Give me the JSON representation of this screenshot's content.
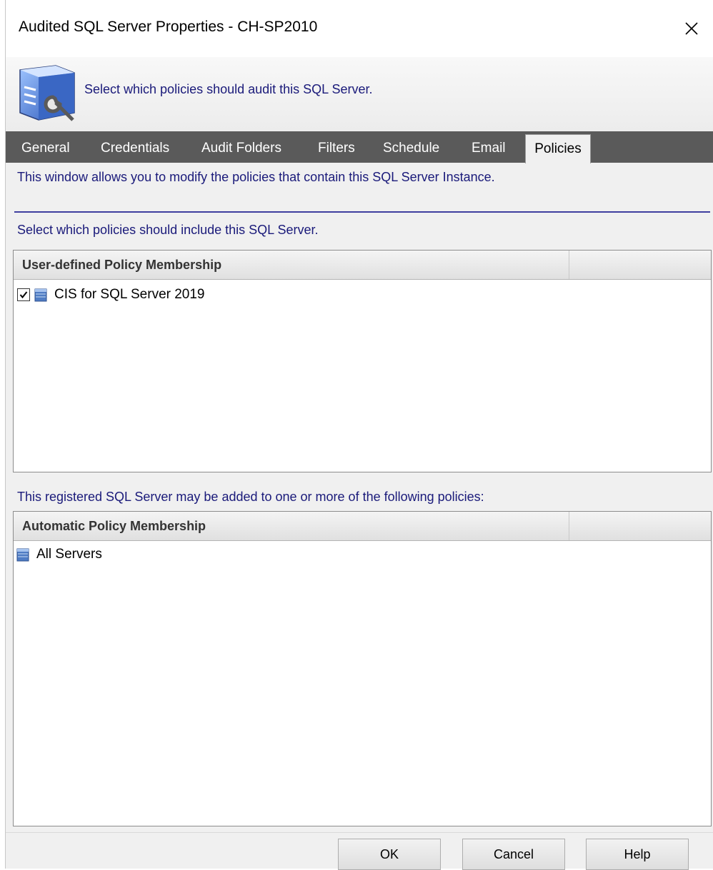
{
  "window": {
    "title": "Audited SQL Server Properties - CH-SP2010"
  },
  "banner": {
    "text": "Select which policies should audit this SQL Server."
  },
  "tabs": [
    {
      "label": "General",
      "active": false
    },
    {
      "label": "Credentials",
      "active": false
    },
    {
      "label": "Audit Folders",
      "active": false
    },
    {
      "label": "Filters",
      "active": false
    },
    {
      "label": "Schedule",
      "active": false
    },
    {
      "label": "Email",
      "active": false
    },
    {
      "label": "Policies",
      "active": true
    }
  ],
  "policies": {
    "info": "This window allows you to modify the policies that contain this SQL Server Instance.",
    "select_prompt": "Select which policies should include this SQL Server.",
    "user_defined": {
      "header": "User-defined Policy Membership",
      "items": [
        {
          "label": "CIS for SQL Server 2019",
          "checked": true
        }
      ]
    },
    "auto_prompt": "This registered SQL Server may be added to one or more of the following policies:",
    "automatic": {
      "header": "Automatic Policy Membership",
      "items": [
        {
          "label": "All Servers"
        }
      ]
    }
  },
  "buttons": {
    "ok": "OK",
    "cancel": "Cancel",
    "help": "Help"
  },
  "colors": {
    "info_text": "#1a1a7a",
    "tabstrip": "#5a5a5a",
    "divider": "#3f3f9f"
  },
  "icons": {
    "banner": "server-wrench-icon",
    "close": "close-icon",
    "policy": "database-icon"
  }
}
